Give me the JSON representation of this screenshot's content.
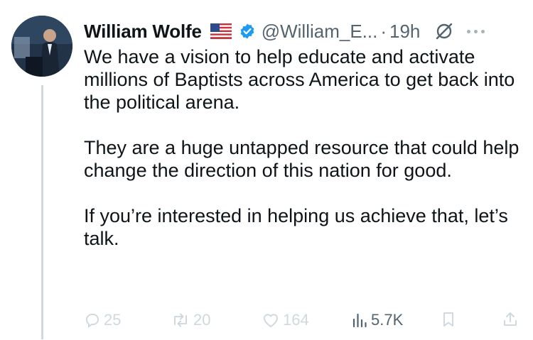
{
  "tweet": {
    "author_name": "William Wolfe",
    "handle": "@William_E...",
    "separator": "·",
    "time": "19h",
    "paragraphs": [
      "We have a vision to help educate and activate millions of Baptists across America to get back into the political arena.",
      "They are a huge untapped resource that could help change the direction of this nation for good.",
      "If you’re interested in helping us achieve that, let’s talk."
    ]
  },
  "actions": {
    "replies": "25",
    "reposts": "20",
    "likes": "164",
    "views": "5.7K"
  },
  "colors": {
    "text": "#0f1419",
    "muted": "#536471",
    "faint": "#cfd9de",
    "verified": "#1d9bf0"
  },
  "icons": [
    "us-flag-icon",
    "verified-badge-icon",
    "grok-icon",
    "more-icon",
    "reply-icon",
    "repost-icon",
    "like-icon",
    "views-icon",
    "bookmark-icon",
    "share-icon"
  ]
}
